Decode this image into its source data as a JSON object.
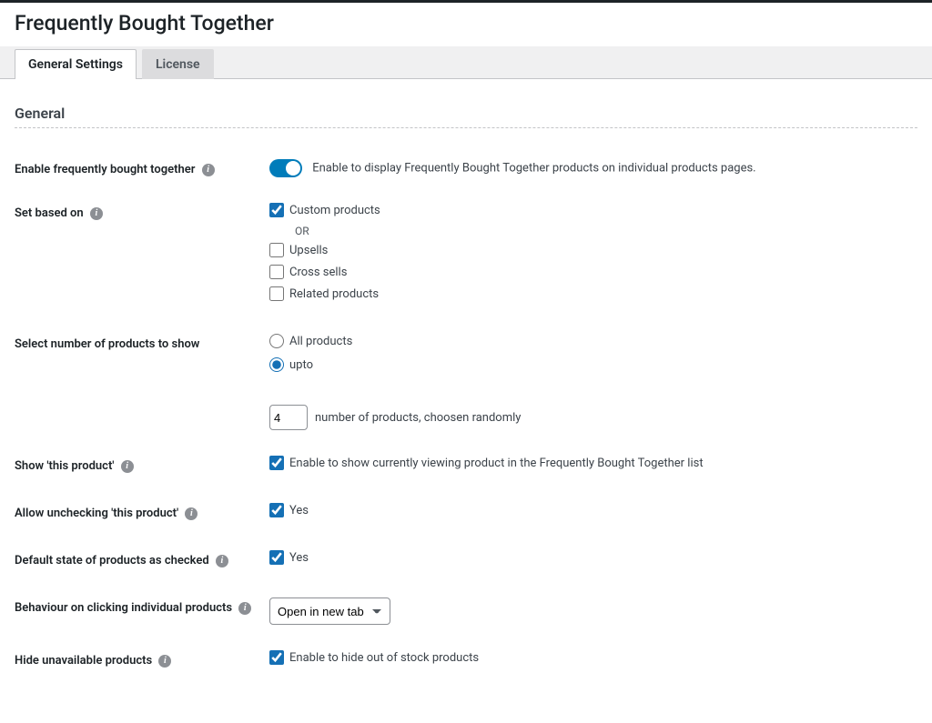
{
  "page": {
    "title": "Frequently Bought Together",
    "tabs": {
      "general": "General Settings",
      "license": "License"
    },
    "section_heading": "General"
  },
  "info_glyph": "i",
  "settings": {
    "enable": {
      "label": "Enable frequently bought together",
      "description": "Enable to display Frequently Bought Together products on individual products pages."
    },
    "set_based_on": {
      "label": "Set based on",
      "options": {
        "custom": "Custom products",
        "or": "OR",
        "upsells": "Upsells",
        "crosssells": "Cross sells",
        "related": "Related products"
      }
    },
    "num_products": {
      "label": "Select number of products to show",
      "options": {
        "all": "All products",
        "upto": "upto"
      },
      "value": "4",
      "suffix": "number of products, choosen randomly"
    },
    "show_this_product": {
      "label": "Show 'this product'",
      "description": "Enable to show currently viewing product in the Frequently Bought Together list"
    },
    "allow_uncheck": {
      "label": "Allow unchecking 'this product'",
      "description": "Yes"
    },
    "default_checked": {
      "label": "Default state of products as checked",
      "description": "Yes"
    },
    "behaviour": {
      "label": "Behaviour on clicking individual products",
      "selected": "Open in new tab"
    },
    "hide_unavailable": {
      "label": "Hide unavailable products",
      "description": "Enable to hide out of stock products"
    }
  }
}
